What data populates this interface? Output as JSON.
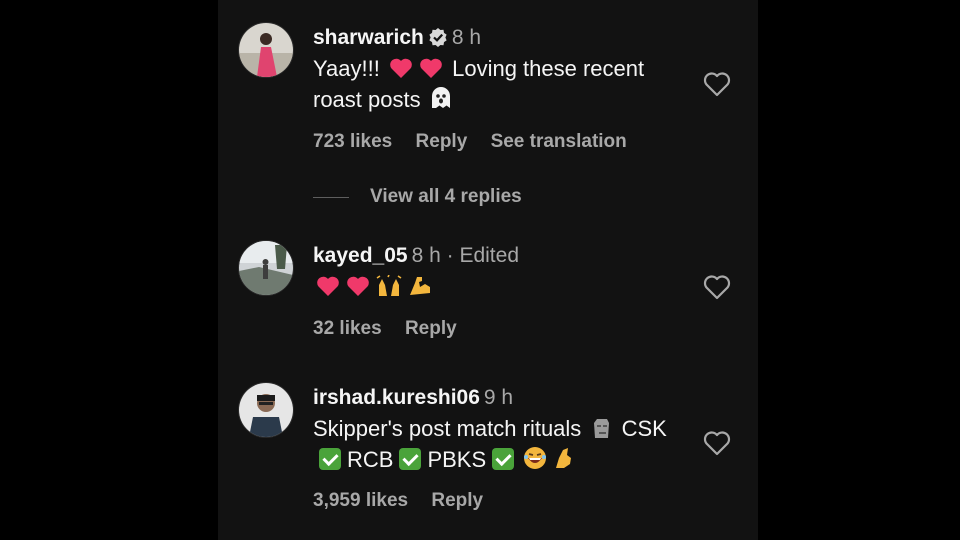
{
  "comments": [
    {
      "username": "sharwarich",
      "verified": true,
      "time": "8 h",
      "text_parts": [
        "Yaay!!!",
        "Loving these recent",
        "roast posts"
      ],
      "likes": "723 likes",
      "reply": "Reply",
      "translation": "See translation",
      "view_replies": "View all 4 replies"
    },
    {
      "username": "kayed_05",
      "time": "8 h · Edited",
      "likes": "32 likes",
      "reply": "Reply"
    },
    {
      "username": "irshad.kureshi06",
      "time": "9 h",
      "text_parts": [
        "Skipper's post match rituals",
        "CSK",
        "RCB",
        "PBKS"
      ],
      "likes": "3,959 likes",
      "reply": "Reply"
    }
  ],
  "icons": {
    "heart": "heart-outline-icon",
    "verified": "verified-badge-icon",
    "emoji_heart_color": "#f0396a",
    "check_color": "#4aa33a"
  }
}
